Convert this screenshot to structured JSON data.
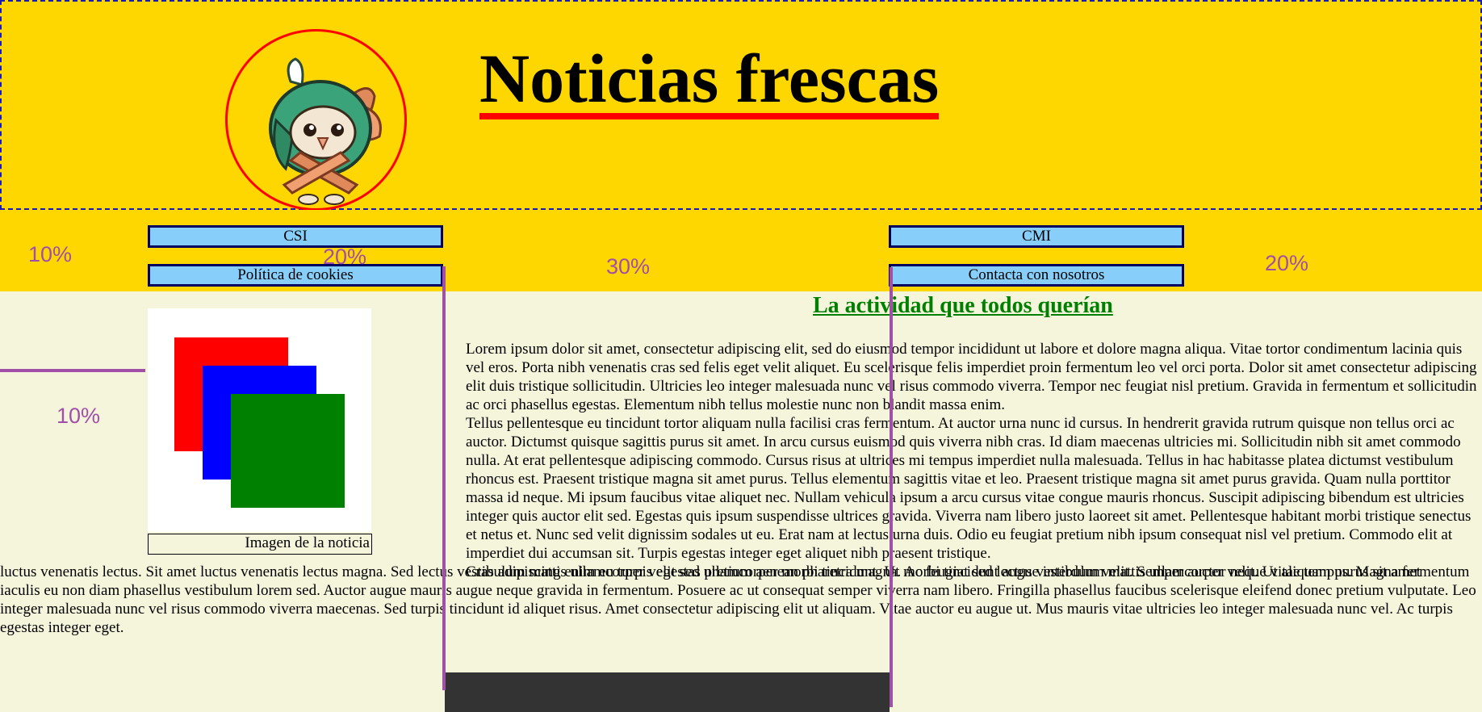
{
  "header": {
    "title": "Noticias frescas",
    "logo_icon": "bird-mascot-icon"
  },
  "nav": {
    "items": [
      {
        "label": "CSI"
      },
      {
        "label": "Política de cookies"
      },
      {
        "label": "CMI"
      },
      {
        "label": "Contacta con nosotros"
      }
    ]
  },
  "annotations": {
    "top_left": "10%",
    "nav_col1": "20%",
    "middle": "30%",
    "right": "20%",
    "side": "10%"
  },
  "figure": {
    "caption": "Imagen de la noticia",
    "colors": [
      "#ff0000",
      "#0000ff",
      "#008000"
    ]
  },
  "article": {
    "title": "La actividad que todos querían",
    "p1": "Lorem ipsum dolor sit amet, consectetur adipiscing elit, sed do eiusmod tempor incididunt ut labore et dolore magna aliqua. Vitae tortor condimentum lacinia quis vel eros. Porta nibh venenatis cras sed felis eget velit aliquet. Eu scelerisque felis imperdiet proin fermentum leo vel orci porta. Dolor sit amet consectetur adipiscing elit duis tristique sollicitudin. Ultricies leo integer malesuada nunc vel risus commodo viverra. Tempor nec feugiat nisl pretium. Gravida in fermentum et sollicitudin ac orci phasellus egestas. Elementum nibh tellus molestie nunc non blandit massa enim.",
    "p2": "Tellus pellentesque eu tincidunt tortor aliquam nulla facilisi cras fermentum. At auctor urna nunc id cursus. In hendrerit gravida rutrum quisque non tellus orci ac auctor. Dictumst quisque sagittis purus sit amet. In arcu cursus euismod quis viverra nibh cras. Id diam maecenas ultricies mi. Sollicitudin nibh sit amet commodo nulla. At erat pellentesque adipiscing commodo. Cursus risus at ultrices mi tempus imperdiet nulla malesuada. Tellus in hac habitasse platea dictumst vestibulum rhoncus est. Praesent tristique magna sit amet purus. Tellus elementum sagittis vitae et leo. Praesent tristique magna sit amet purus gravida. Quam nulla porttitor massa id neque. Mi ipsum faucibus vitae aliquet nec. Nullam vehicula ipsum a arcu cursus vitae congue mauris rhoncus. Suscipit adipiscing bibendum est ultricies integer quis auctor elit sed. Egestas quis ipsum suspendisse ultrices gravida. Viverra nam libero justo laoreet sit amet. Pellentesque habitant morbi tristique senectus et netus et. Nunc sed velit dignissim sodales ut eu. Erat nam at lectus urna duis. Odio eu feugiat pretium nibh ipsum consequat nisl vel pretium. Commodo elit at imperdiet dui accumsan sit. Turpis egestas integer eget aliquet nibh praesent tristique.",
    "p3_start": "Cras adipiscing enim eu turpis egestas pretium aenean pharetra magna. Ac feugiat sed lectus vestibulum mattis ullamcorper velit. Ut aliquam purus sit amet",
    "p3_rest": "luctus venenatis lectus. Sit amet luctus venenatis lectus magna. Sed lectus vestibulum mattis ullamcorper velit sed ullamcorper morbi tincidunt. Ut morbi tincidunt augue interdum velit. Semper auctor neque vitae tempus. Magna fermentum iaculis eu non diam phasellus vestibulum lorem sed. Auctor augue mauris augue neque gravida in fermentum. Posuere ac ut consequat semper viverra nam libero. Fringilla phasellus faucibus scelerisque eleifend donec pretium vulputate. Leo integer malesuada nunc vel risus commodo viverra maecenas. Sed turpis tincidunt id aliquet risus. Amet consectetur adipiscing elit ut aliquam. Vitae auctor eu augue ut. Mus mauris vitae ultricies leo integer malesuada nunc vel. Ac turpis egestas integer eget."
  }
}
